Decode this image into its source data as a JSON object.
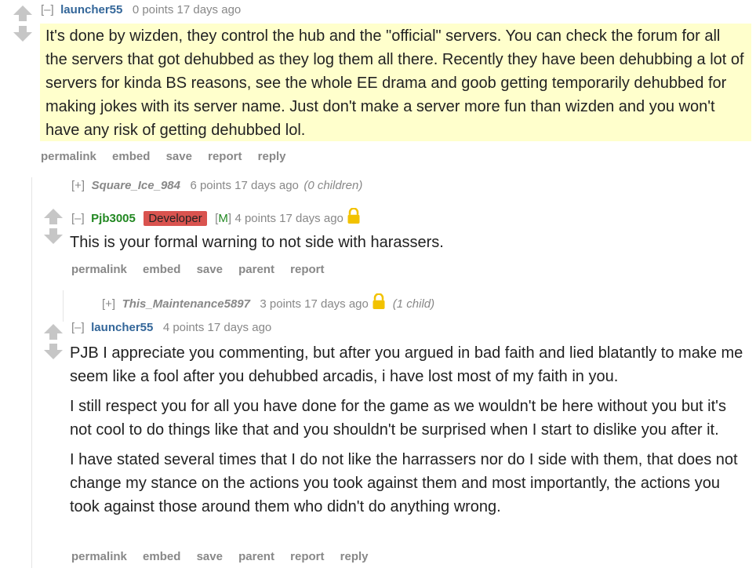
{
  "comments": {
    "c1": {
      "toggle": "[–]",
      "author": "launcher55",
      "meta": "0 points 17 days ago",
      "body": "It's done by wizden, they control the hub and the \"official\" servers. You can check the forum for all the servers that got dehubbed as they log them all there. Recently they have been dehubbing a lot of servers for kinda BS reasons, see the whole EE drama and goob getting temporarily dehubbed for making jokes with its server name. Just don't make a server more fun than wizden and you won't have any risk of getting dehubbed lol.",
      "actions": [
        "permalink",
        "embed",
        "save",
        "report",
        "reply"
      ]
    },
    "c2": {
      "toggle": "[+]",
      "author": "Square_Ice_984",
      "meta": "6 points 17 days ago",
      "children": "(0 children)"
    },
    "c3": {
      "toggle": "[–]",
      "author": "Pjb3005",
      "flair": "Developer",
      "mod_open": "[",
      "mod": "M",
      "mod_close": "]",
      "meta": "4 points 17 days ago",
      "body": "This is your formal warning to not side with harassers.",
      "actions": [
        "permalink",
        "embed",
        "save",
        "parent",
        "report"
      ]
    },
    "c4": {
      "toggle": "[+]",
      "author": "This_Maintenance5897",
      "meta": "3 points 17 days ago",
      "children": "(1 child)"
    },
    "c5": {
      "toggle": "[–]",
      "author": "launcher55",
      "meta": "4 points 17 days ago",
      "paragraphs": [
        "PJB I appreciate you commenting, but after you argued in bad faith and lied blatantly to make me seem like a fool after you dehubbed arcadis, i have lost most of my faith in you.",
        "I still respect you for all you have done for the game as we wouldn't be here without you but it's not cool to do things like that and you shouldn't be surprised when I start to dislike you after it.",
        "I have stated several times that I do not like the harrassers nor do I side with them, that does not change my stance on the actions you took against them and most importantly, the actions you took against those around them who didn't do anything wrong."
      ],
      "actions": [
        "permalink",
        "embed",
        "save",
        "parent",
        "report",
        "reply"
      ]
    }
  },
  "icons": [
    "upvote-icon",
    "downvote-icon",
    "lock-icon"
  ],
  "colors": {
    "highlight": "#ffffcc",
    "author": "#336699",
    "mod_green": "#228822",
    "flair_bg": "#d9534f",
    "lock": "#f2c200"
  }
}
